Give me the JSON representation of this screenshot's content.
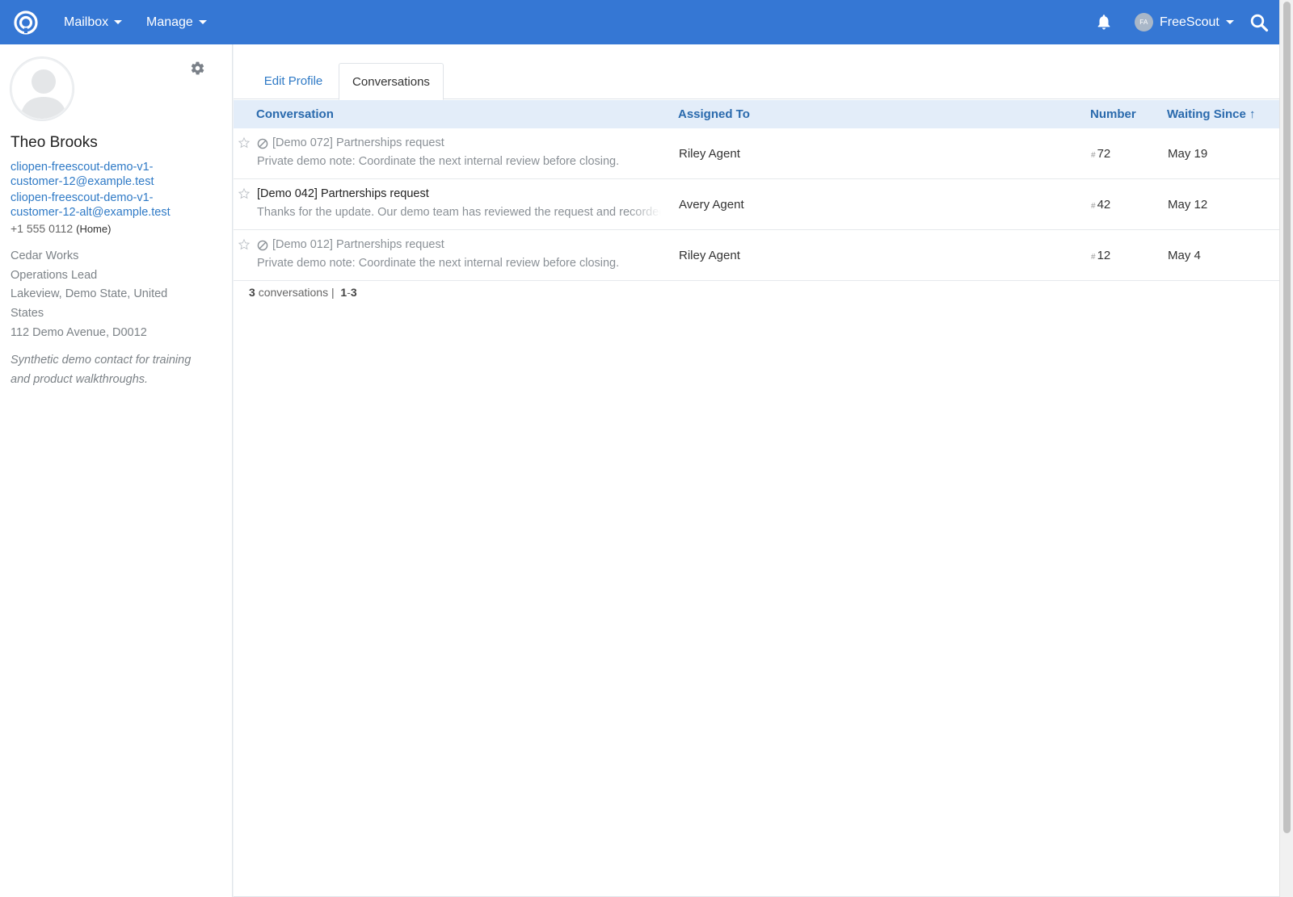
{
  "nav": {
    "mailbox_label": "Mailbox",
    "manage_label": "Manage",
    "user_initials": "FA",
    "user_name": "FreeScout"
  },
  "customer": {
    "name": "Theo Brooks",
    "email_1_line1": "cliopen-freescout-demo-v1-",
    "email_1_line2": "customer-12@example.test",
    "email_2_line1": "cliopen-freescout-demo-v1-",
    "email_2_line2": "customer-12-alt@example.test",
    "phone": "+1 555 0112",
    "phone_type": "(Home)",
    "company": "Cedar Works",
    "job_title": "Operations Lead",
    "address": "Lakeview, Demo State, United States",
    "street": "112 Demo Avenue, D0012",
    "notes": "Synthetic demo contact for training and product walkthroughs."
  },
  "tabs": {
    "edit_profile": "Edit Profile",
    "conversations": "Conversations"
  },
  "table": {
    "headers": {
      "conversation": "Conversation",
      "assigned_to": "Assigned To",
      "number": "Number",
      "waiting_since": "Waiting Since ↑"
    },
    "rows": [
      {
        "subject": "[Demo 072] Partnerships request",
        "preview": "Private demo note: Coordinate the next internal review before closing.",
        "assigned": "Riley Agent",
        "hash": "#",
        "number": "72",
        "waiting": "May 19"
      },
      {
        "subject": "[Demo 042] Partnerships request",
        "preview": "Thanks for the update. Our demo team has reviewed the request and recorded the details.",
        "assigned": "Avery Agent",
        "hash": "#",
        "number": "42",
        "waiting": "May 12"
      },
      {
        "subject": "[Demo 012] Partnerships request",
        "preview": "Private demo note: Coordinate the next internal review before closing.",
        "assigned": "Riley Agent",
        "hash": "#",
        "number": "12",
        "waiting": "May 4"
      }
    ]
  },
  "pager": {
    "count": "3",
    "count_label": "conversations",
    "separator": "|",
    "range_start": "1",
    "range_dash": "-",
    "range_end": "3"
  },
  "colors": {
    "nav_bg": "#3577d4",
    "link": "#2f7ac6",
    "header_bg": "#e3edf9",
    "header_text": "#2a6aad"
  },
  "icons": {
    "logo": "freescout-logo-icon",
    "bell": "bell-icon",
    "search": "search-icon",
    "gear": "gear-icon",
    "star": "star-outline-icon",
    "ban": "no-entry-icon"
  }
}
